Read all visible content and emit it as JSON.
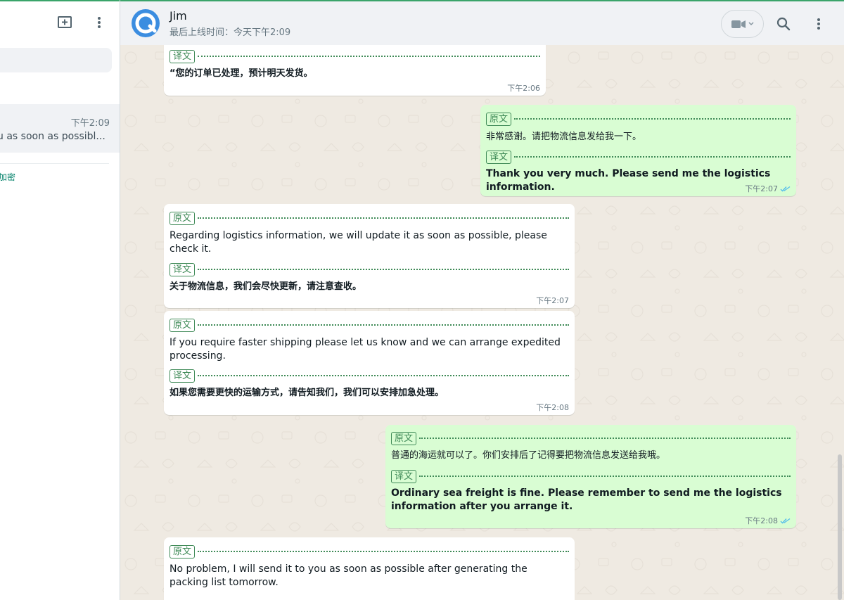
{
  "sidebar": {
    "chat": {
      "time": "下午2:09",
      "preview": "u as soon as possibl..."
    },
    "encrypt_note": "加密",
    "icons": [
      "new-chat-icon",
      "menu-dots-icon"
    ]
  },
  "header": {
    "contact_name": "Jim",
    "last_seen": "最后上线时间：今天下午2:09",
    "icons": [
      "video-call-icon",
      "chevron-down-icon",
      "search-icon",
      "menu-dots-icon"
    ]
  },
  "labels": {
    "original": "原文",
    "translation": "译文"
  },
  "messages": [
    {
      "direction": "in",
      "translation": "“您的订单已处理，预计明天发货。",
      "time": "下午2:06"
    },
    {
      "direction": "out",
      "original": "非常感谢。请把物流信息发给我一下。",
      "translation": "Thank you very much. Please send me the logistics information.",
      "time": "下午2:07"
    },
    {
      "direction": "in",
      "original": "Regarding logistics information, we will update it as soon as possible, please check it.",
      "translation": "关于物流信息，我们会尽快更新，请注意查收。",
      "time": "下午2:07"
    },
    {
      "direction": "in",
      "original": "If you require faster shipping please let us know and we can arrange expedited processing.",
      "translation": "如果您需要更快的运输方式，请告知我们，我们可以安排加急处理。",
      "time": "下午2:08"
    },
    {
      "direction": "out",
      "original": "普通的海运就可以了。你们安排后了记得要把物流信息发送给我哦。",
      "translation": "Ordinary sea freight is fine. Please remember to send me the logistics information after you arrange it.",
      "time": "下午2:08"
    },
    {
      "direction": "in",
      "original": "No problem, I will send it to you as soon as possible after generating the packing list tomorrow."
    }
  ],
  "colors": {
    "accent": "#3aa46a",
    "outgoing_bubble": "#d9fdd3",
    "tag_green": "#3f8a57",
    "read_ticks": "#53bdeb"
  }
}
